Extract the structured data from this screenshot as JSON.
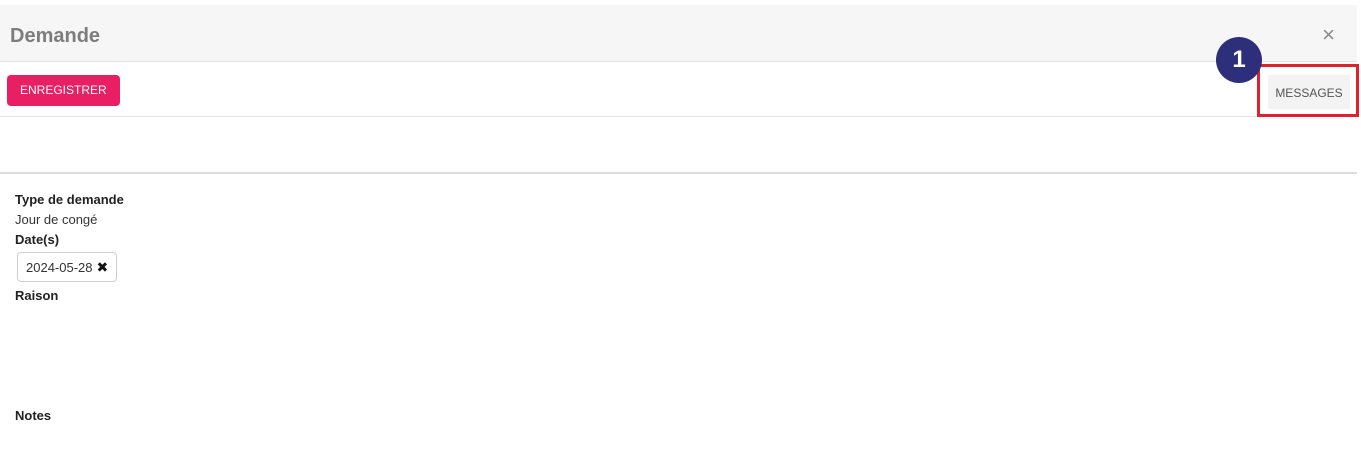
{
  "modal": {
    "title": "Demande",
    "close_glyph": "×"
  },
  "toolbar": {
    "save_label": "ENREGISTRER",
    "messages_label": "MESSAGES",
    "callout_number": "1"
  },
  "form": {
    "type_label": "Type de demande",
    "type_value": "Jour de congé",
    "dates_label": "Date(s)",
    "dates": [
      "2024-05-28"
    ],
    "chip_remove_glyph": "✖",
    "reason_label": "Raison",
    "notes_label": "Notes"
  },
  "colors": {
    "primary": "#e91e63",
    "callout": "#2d2f7a",
    "highlight": "#e0202a"
  },
  "icons": [
    "close-icon",
    "remove-chip-icon"
  ]
}
